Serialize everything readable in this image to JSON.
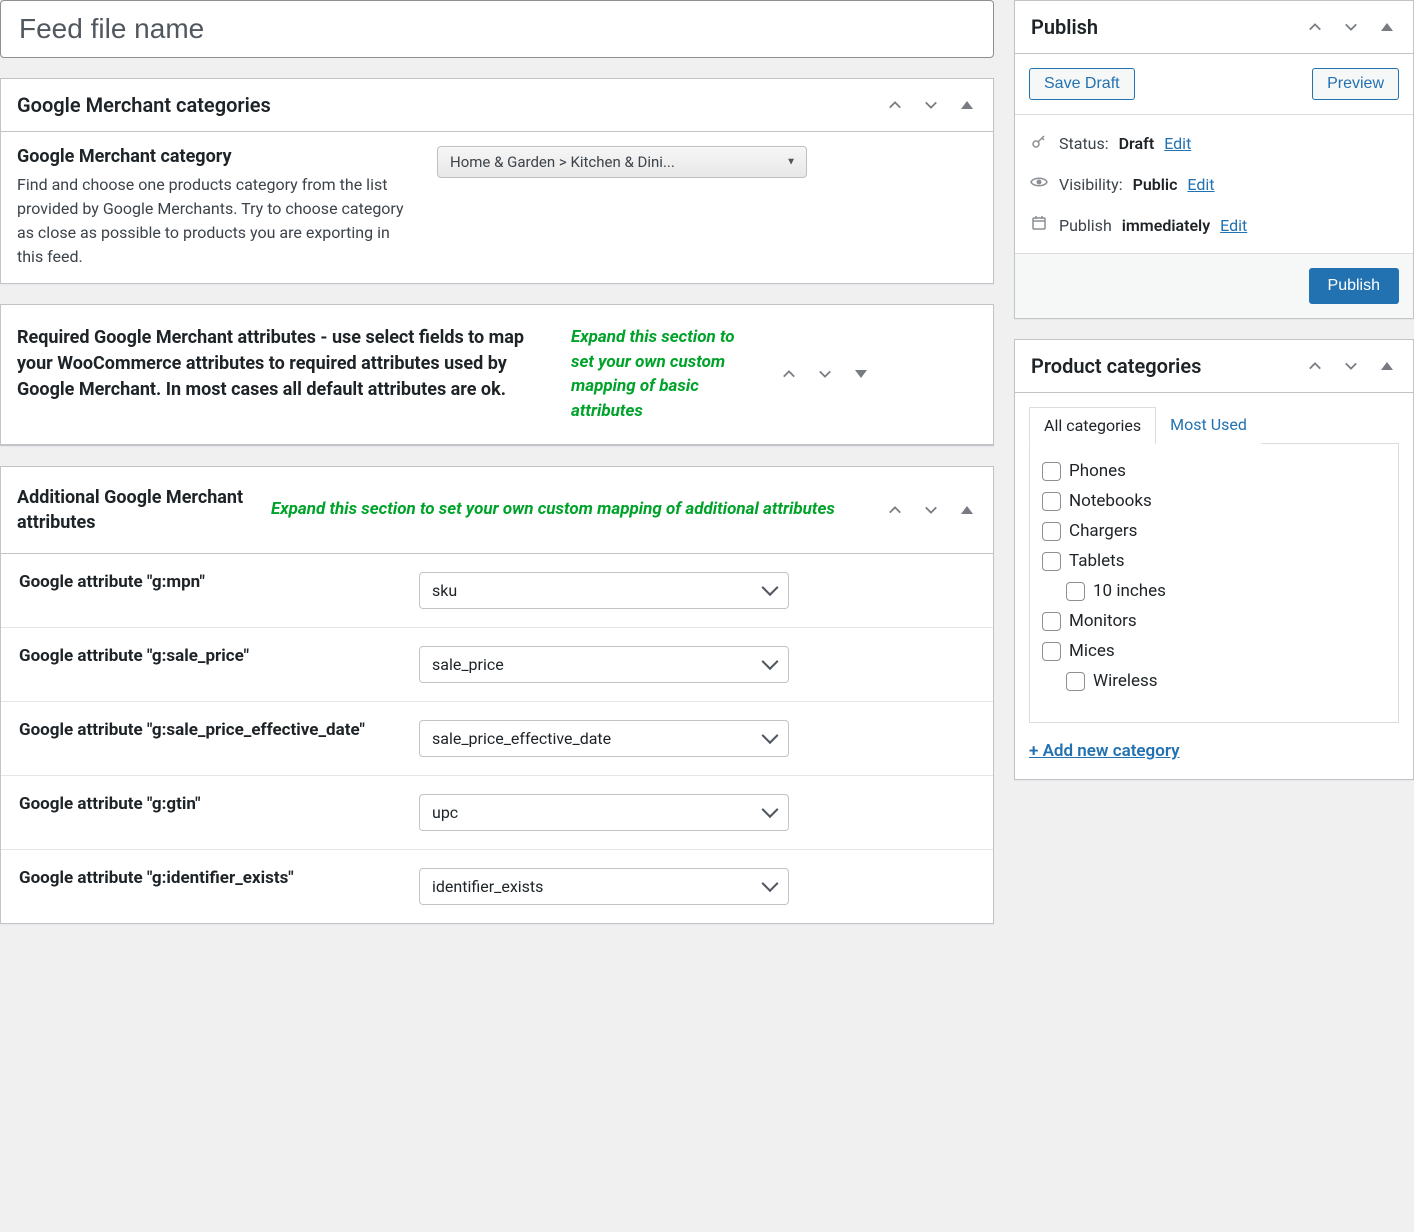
{
  "title": {
    "placeholder": "Feed file name",
    "value": ""
  },
  "gmc_category": {
    "panel_title": "Google Merchant categories",
    "field_label": "Google Merchant category",
    "field_help": "Find and choose one products category from the list provided by Google Merchants. Try to choose category as close as possible to products you are exporting in this feed.",
    "selected": "Home & Garden > Kitchen & Dini..."
  },
  "required_attrs": {
    "title": "Required Google Merchant attributes - use select fields to map your WooCommerce attributes to required attributes used by Google Merchant. In most cases all default attributes are ok.",
    "hint": "Expand this section to set your own custom mapping of basic attributes"
  },
  "additional_attrs": {
    "title": "Additional Google Merchant attributes",
    "hint": "Expand this section to set your own custom mapping of additional attributes",
    "rows": [
      {
        "label": "Google attribute \"g:mpn\"",
        "value": "sku"
      },
      {
        "label": "Google attribute \"g:sale_price\"",
        "value": "sale_price"
      },
      {
        "label": "Google attribute \"g:sale_price_effective_date\"",
        "value": "sale_price_effective_date"
      },
      {
        "label": "Google attribute \"g:gtin\"",
        "value": "upc"
      },
      {
        "label": "Google attribute \"g:identifier_exists\"",
        "value": "identifier_exists"
      }
    ]
  },
  "publish": {
    "panel_title": "Publish",
    "save_draft": "Save Draft",
    "preview": "Preview",
    "status_label": "Status:",
    "status_value": "Draft",
    "visibility_label": "Visibility:",
    "visibility_value": "Public",
    "schedule_label": "Publish",
    "schedule_value": "immediately",
    "edit_link": "Edit",
    "submit": "Publish"
  },
  "categories": {
    "panel_title": "Product categories",
    "tab_all": "All categories",
    "tab_most": "Most Used",
    "items": [
      {
        "name": "Phones",
        "indent": 0
      },
      {
        "name": "Notebooks",
        "indent": 0
      },
      {
        "name": "Chargers",
        "indent": 0
      },
      {
        "name": "Tablets",
        "indent": 0
      },
      {
        "name": "10 inches",
        "indent": 1
      },
      {
        "name": "Monitors",
        "indent": 0
      },
      {
        "name": "Mices",
        "indent": 0
      },
      {
        "name": "Wireless",
        "indent": 1
      }
    ],
    "add_new": "+ Add new category"
  }
}
